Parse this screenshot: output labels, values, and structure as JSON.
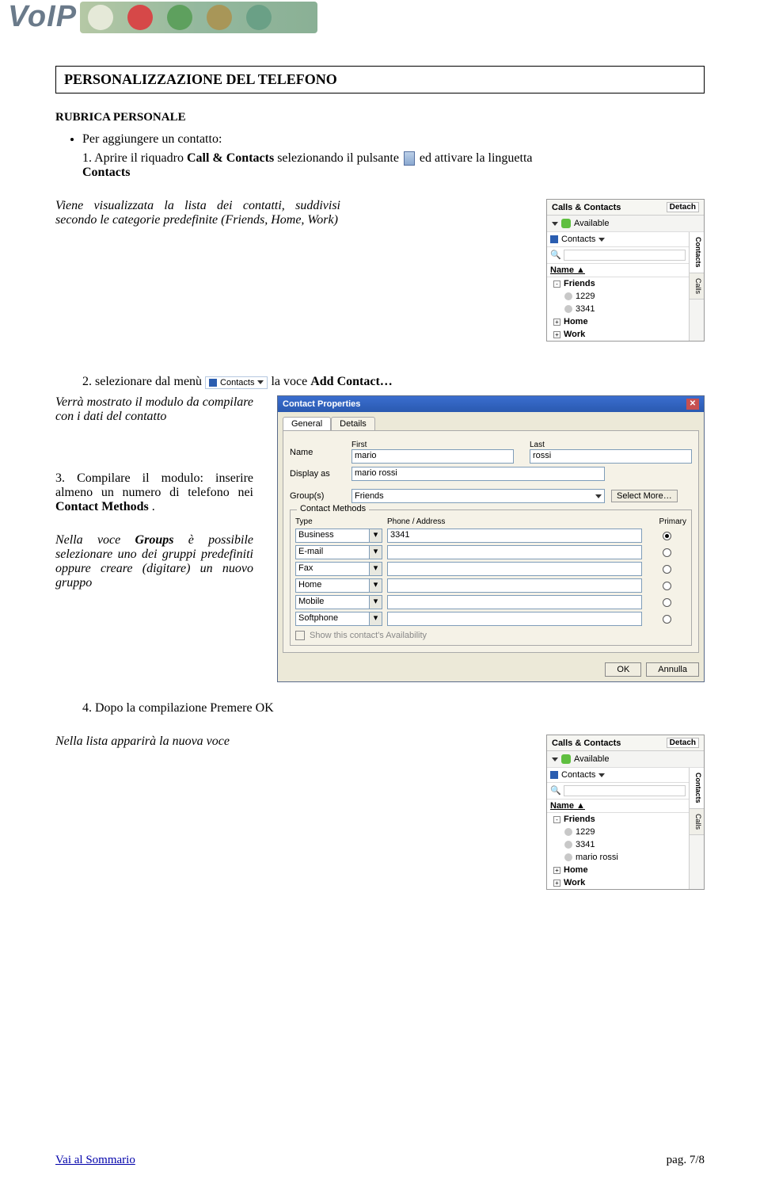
{
  "header": {
    "logo_text": "VoIP"
  },
  "section_title": "PERSONALIZZAZIONE DEL TELEFONO",
  "subsection_title": "RUBRICA PERSONALE",
  "bullet1": "Per aggiungere un contatto:",
  "step1_pre": "1.  Aprire il riquadro ",
  "step1_bold1": "Call & Contacts",
  "step1_mid": " selezionando il pulsante ",
  "step1_post": " ed attivare la linguetta ",
  "step1_bold2": "Contacts",
  "para1": "Viene visualizzata la lista dei contatti, suddivisi secondo le categorie predefinite (Friends, Home, Work)",
  "step2_pre": "2.  selezionare dal menù ",
  "step2_btn": "Contacts",
  "step2_post": " la voce ",
  "step2_bold": "Add Contact…",
  "para2": "Verrà mostrato il modulo da compilare con i dati del contatto",
  "step3_pre": "3.  Compilare il modulo: inserire almeno un numero di telefono nei ",
  "step3_bold": "Contact Methods",
  "step3_post": ".",
  "para3_pre": "Nella voce ",
  "para3_bold": "Groups",
  "para3_post": " è possibile selezionare uno dei gruppi predefiniti oppure creare (digitare) un nuovo gruppo",
  "step4": "4.  Dopo la compilazione Premere OK",
  "para4": "Nella lista apparirà la nuova voce",
  "panel1": {
    "title": "Calls & Contacts",
    "detach": "Detach",
    "status": "Available",
    "contacts_label": "Contacts",
    "name_header": "Name",
    "tabs": [
      "Contacts",
      "Calls"
    ],
    "items": [
      {
        "label": "Friends",
        "exp": "-",
        "children": [
          "1229",
          "3341"
        ]
      },
      {
        "label": "Home",
        "exp": "+"
      },
      {
        "label": "Work",
        "exp": "+"
      }
    ]
  },
  "panel2": {
    "items": [
      {
        "label": "Friends",
        "exp": "-",
        "children": [
          "1229",
          "3341",
          "mario rossi"
        ]
      },
      {
        "label": "Home",
        "exp": "+"
      },
      {
        "label": "Work",
        "exp": "+"
      }
    ]
  },
  "dialog": {
    "title": "Contact Properties",
    "tabs": [
      "General",
      "Details"
    ],
    "name_label": "Name",
    "first_label": "First",
    "last_label": "Last",
    "first_val": "mario",
    "last_val": "rossi",
    "display_label": "Display as",
    "display_val": "mario rossi",
    "groups_label": "Group(s)",
    "groups_val": "Friends",
    "select_more": "Select More…",
    "cm_legend": "Contact Methods",
    "cm_type": "Type",
    "cm_phone": "Phone / Address",
    "cm_primary": "Primary",
    "cm_rows": [
      {
        "type": "Business",
        "value": "3341",
        "primary": true
      },
      {
        "type": "E-mail",
        "value": "",
        "primary": false
      },
      {
        "type": "Fax",
        "value": "",
        "primary": false
      },
      {
        "type": "Home",
        "value": "",
        "primary": false
      },
      {
        "type": "Mobile",
        "value": "",
        "primary": false
      },
      {
        "type": "Softphone",
        "value": "",
        "primary": false
      }
    ],
    "availability": "Show this contact's Availability",
    "ok": "OK",
    "cancel": "Annulla"
  },
  "footer": {
    "link": "Vai al Sommario",
    "page": "pag. 7/8"
  }
}
